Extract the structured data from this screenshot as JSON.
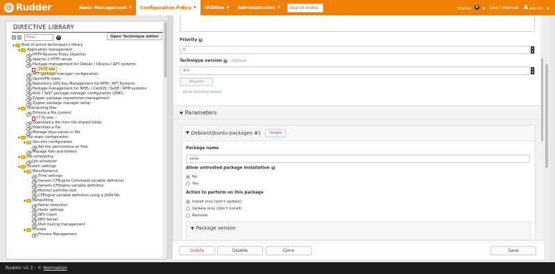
{
  "app": {
    "name": "Rudder"
  },
  "nav": {
    "items": [
      {
        "label": "Node Management",
        "active": false
      },
      {
        "label": "Configuration Policy",
        "active": true
      },
      {
        "label": "Utilities",
        "active": false
      },
      {
        "label": "Administration",
        "active": false
      }
    ],
    "search_placeholder": "Search nodes",
    "status_label": "Status",
    "user_manual": "User manual",
    "user": "admin"
  },
  "library": {
    "title": "DIRECTIVE LIBRARY",
    "filter_placeholder": "Filter",
    "open_technique": "Open Technique editor",
    "tree": [
      {
        "level": 0,
        "type": "folder",
        "label": "Root of active techniques's library"
      },
      {
        "level": 1,
        "type": "folder",
        "label": "Application management"
      },
      {
        "level": 2,
        "type": "technique",
        "label": "HTTP Reverse Proxy (Apache)"
      },
      {
        "level": 2,
        "type": "technique",
        "label": "Apache 2 HTTP server"
      },
      {
        "level": 2,
        "type": "technique",
        "label": "Package management for Debian / Ubuntu / APT systems"
      },
      {
        "level": 3,
        "type": "directive",
        "label": "[4.0] aaa",
        "selected": true,
        "warn": true
      },
      {
        "level": 2,
        "type": "technique",
        "label": "APT package manager configuration"
      },
      {
        "level": 2,
        "type": "technique",
        "label": "OpenVPN client"
      },
      {
        "level": 2,
        "type": "technique",
        "label": "Repository GPG Key Management for RPM / APT Systems"
      },
      {
        "level": 2,
        "type": "technique",
        "label": "Package management for RHEL / CentOS / SuSE / RPM systems"
      },
      {
        "level": 2,
        "type": "technique",
        "label": "RUG / YaST package manager configuration (ZMD)"
      },
      {
        "level": 2,
        "type": "technique",
        "label": "Zypper package repositories management"
      },
      {
        "level": 2,
        "type": "technique",
        "label": "Zypper package manager setup"
      },
      {
        "level": 1,
        "type": "folder",
        "label": "Distributing files"
      },
      {
        "level": 2,
        "type": "technique",
        "label": "Enforce a file content"
      },
      {
        "level": 3,
        "type": "directive",
        "label": "[7.0] aaa",
        "warn": true
      },
      {
        "level": 2,
        "type": "technique",
        "label": "Download a file from the shared folder"
      },
      {
        "level": 2,
        "type": "technique",
        "label": "Download a file"
      },
      {
        "level": 2,
        "type": "technique",
        "label": "Manage keys-values in file"
      },
      {
        "level": 1,
        "type": "folder",
        "label": "File state configuration"
      },
      {
        "level": 2,
        "type": "folder",
        "label": "Security configuration"
      },
      {
        "level": 3,
        "type": "technique",
        "label": "Set the permissions on files"
      },
      {
        "level": 2,
        "type": "technique",
        "label": "Manage files and folders"
      },
      {
        "level": 1,
        "type": "folder",
        "label": "Job scheduling"
      },
      {
        "level": 2,
        "type": "technique",
        "label": "Job scheduler"
      },
      {
        "level": 1,
        "type": "folder",
        "label": "System settings"
      },
      {
        "level": 2,
        "type": "folder",
        "label": "Miscellaneous"
      },
      {
        "level": 3,
        "type": "technique",
        "label": "Time settings"
      },
      {
        "level": 3,
        "type": "technique",
        "label": "Generic CFEngine Command variable definition"
      },
      {
        "level": 3,
        "type": "technique",
        "label": "Generic CFEngine variable definition"
      },
      {
        "level": 3,
        "type": "technique",
        "label": "Monitor partition size"
      },
      {
        "level": 3,
        "type": "technique",
        "label": "CFEngine variable definition using a JSON file"
      },
      {
        "level": 2,
        "type": "folder",
        "label": "Networking"
      },
      {
        "level": 3,
        "type": "technique",
        "label": "Name resolution"
      },
      {
        "level": 3,
        "type": "technique",
        "label": "Hosts settings"
      },
      {
        "level": 3,
        "type": "technique",
        "label": "NFS Client"
      },
      {
        "level": 3,
        "type": "technique",
        "label": "NFS Server"
      },
      {
        "level": 3,
        "type": "technique",
        "label": "IPv4 routing management"
      },
      {
        "level": 2,
        "type": "folder",
        "label": "Process"
      },
      {
        "level": 3,
        "type": "technique",
        "label": "Process Management"
      }
    ]
  },
  "form": {
    "priority_label": "Priority",
    "priority_value": "5",
    "technique_version_label": "Technique version",
    "technique_version_optional": "- Optional",
    "technique_version_value": "4.0",
    "migrate_label": "Migrate",
    "show_tech_details": "Show technical details",
    "parameters_title": "Parameters",
    "section_title": "Debian/Ubuntu packages #1",
    "delete_label": "Delete",
    "package_name_label": "Package name",
    "package_name_value": "aaaa",
    "allow_untrusted_label": "Allow untrusted package installation",
    "allow_untrusted_options": [
      "No",
      "Yes"
    ],
    "allow_untrusted_selected": "No",
    "action_label": "Action to perform on this package",
    "action_options": [
      "Install only (don't update)",
      "Update only (don't install)",
      "Remove"
    ],
    "action_selected": "Install only (don't update)",
    "package_version_title": "Package version"
  },
  "actions": {
    "delete": "Delete",
    "disable": "Disable",
    "clone": "Clone",
    "save": "Save"
  },
  "footer": {
    "version": "Rudder v2.3 - ©",
    "company": "Normation"
  },
  "colors": {
    "brand_orange": "#f08004",
    "danger": "#cc3333",
    "footer_bg": "#1c1c1c"
  }
}
